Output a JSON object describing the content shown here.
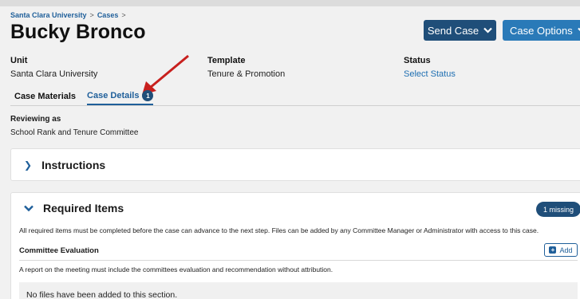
{
  "breadcrumb": {
    "root": "Santa Clara University",
    "section": "Cases",
    "sep": ">"
  },
  "page": {
    "title": "Bucky Bronco"
  },
  "actions": {
    "send_case": "Send Case",
    "case_options": "Case Options"
  },
  "meta": {
    "unit_label": "Unit",
    "unit_value": "Santa Clara University",
    "template_label": "Template",
    "template_value": "Tenure & Promotion",
    "status_label": "Status",
    "status_value": "Select Status"
  },
  "tabs": [
    {
      "label": "Case Materials"
    },
    {
      "label": "Case Details",
      "badge": "1"
    }
  ],
  "reviewing": {
    "label": "Reviewing as",
    "value": "School Rank and Tenure Committee"
  },
  "instructions": {
    "title": "Instructions"
  },
  "required": {
    "title": "Required Items",
    "badge": "1 missing",
    "description": "All required items must be completed before the case can advance to the next step. Files can be added by any Committee Manager or Administrator with access to this case.",
    "committee": {
      "title": "Committee Evaluation",
      "add_label": "Add",
      "description": "A report on the meeting must include the committees evaluation and recommendation without attribution.",
      "empty": "No files have been added to this section."
    }
  },
  "colors": {
    "primary": "#1f4e79",
    "accent": "#2a7ab8",
    "link": "#1f6fb2",
    "arrow": "#c8201e"
  }
}
